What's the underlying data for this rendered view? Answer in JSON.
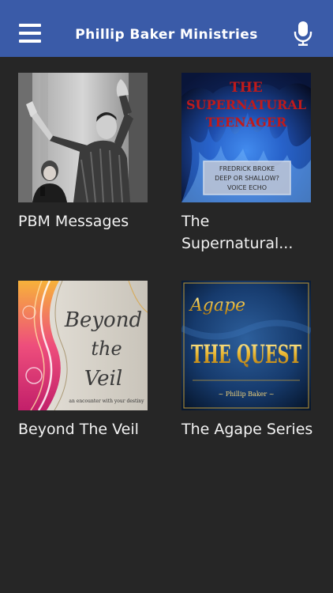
{
  "header": {
    "title": "Phillip Baker Ministries",
    "background": "#3a5ba8",
    "menu_icon": "hamburger-menu-icon",
    "mic_icon": "microphone-icon"
  },
  "tiles": [
    {
      "label": "PBM Messages",
      "image": "preacher-photo"
    },
    {
      "label": "The\nSupernatural...",
      "image": "supernatural-teenager-artwork",
      "art": {
        "title_line1": "THE",
        "title_line2": "SUPERNATURAL",
        "title_line3": "TEENAGER",
        "box_line1": "FREDRICK BROKE",
        "box_line2": "DEEP OR SHALLOW?",
        "box_line3": "VOICE ECHO"
      }
    },
    {
      "label": "Beyond The Veil",
      "image": "beyond-the-veil-artwork",
      "art": {
        "line1": "Beyond",
        "line2": "the",
        "line3": "Veil",
        "subtitle": "an encounter with your destiny"
      }
    },
    {
      "label": "The Agape Series",
      "image": "the-quest-artwork",
      "art": {
        "script": "Agape",
        "title": "THE QUEST",
        "author": "~ Phillip Baker ~"
      }
    }
  ]
}
